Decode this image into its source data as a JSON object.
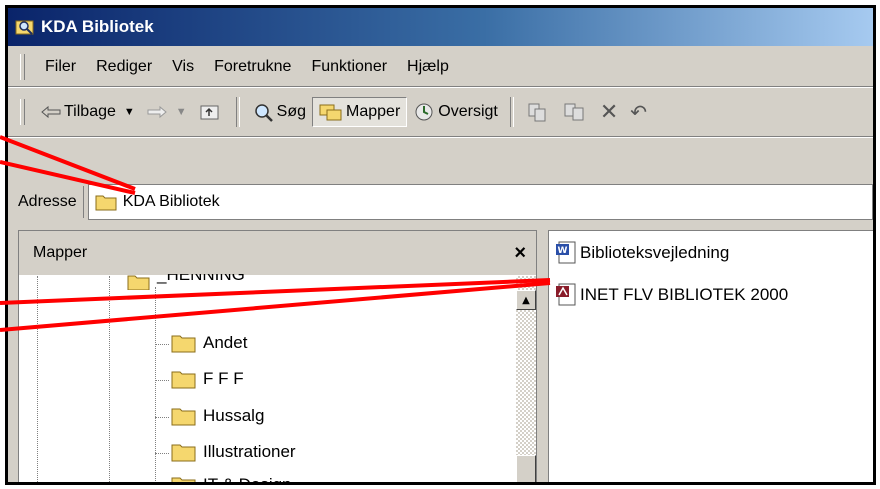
{
  "window": {
    "title": "KDA Bibliotek"
  },
  "menu": {
    "items": [
      "Filer",
      "Rediger",
      "Vis",
      "Foretrukne",
      "Funktioner",
      "Hjælp"
    ]
  },
  "toolbar": {
    "back_label": "Tilbage",
    "search_label": "Søg",
    "folders_label": "Mapper",
    "overview_label": "Oversigt"
  },
  "address": {
    "label": "Adresse",
    "value": "KDA Bibliotek"
  },
  "folders_pane": {
    "title": "Mapper",
    "close": "×",
    "partial_item": "_HENNING",
    "items": [
      "Andet",
      "F F F",
      "Hussalg",
      "Illustrationer",
      "IT & Design"
    ]
  },
  "files": [
    {
      "name": "Biblioteksvejledning",
      "icon": "word-document-icon"
    },
    {
      "name": "INET FLV BIBLIOTEK 2000",
      "icon": "access-database-icon"
    }
  ],
  "colors": {
    "annotation_line": "#ff0000",
    "title_bar": "#0a246a",
    "folder": "#f5d76e"
  }
}
